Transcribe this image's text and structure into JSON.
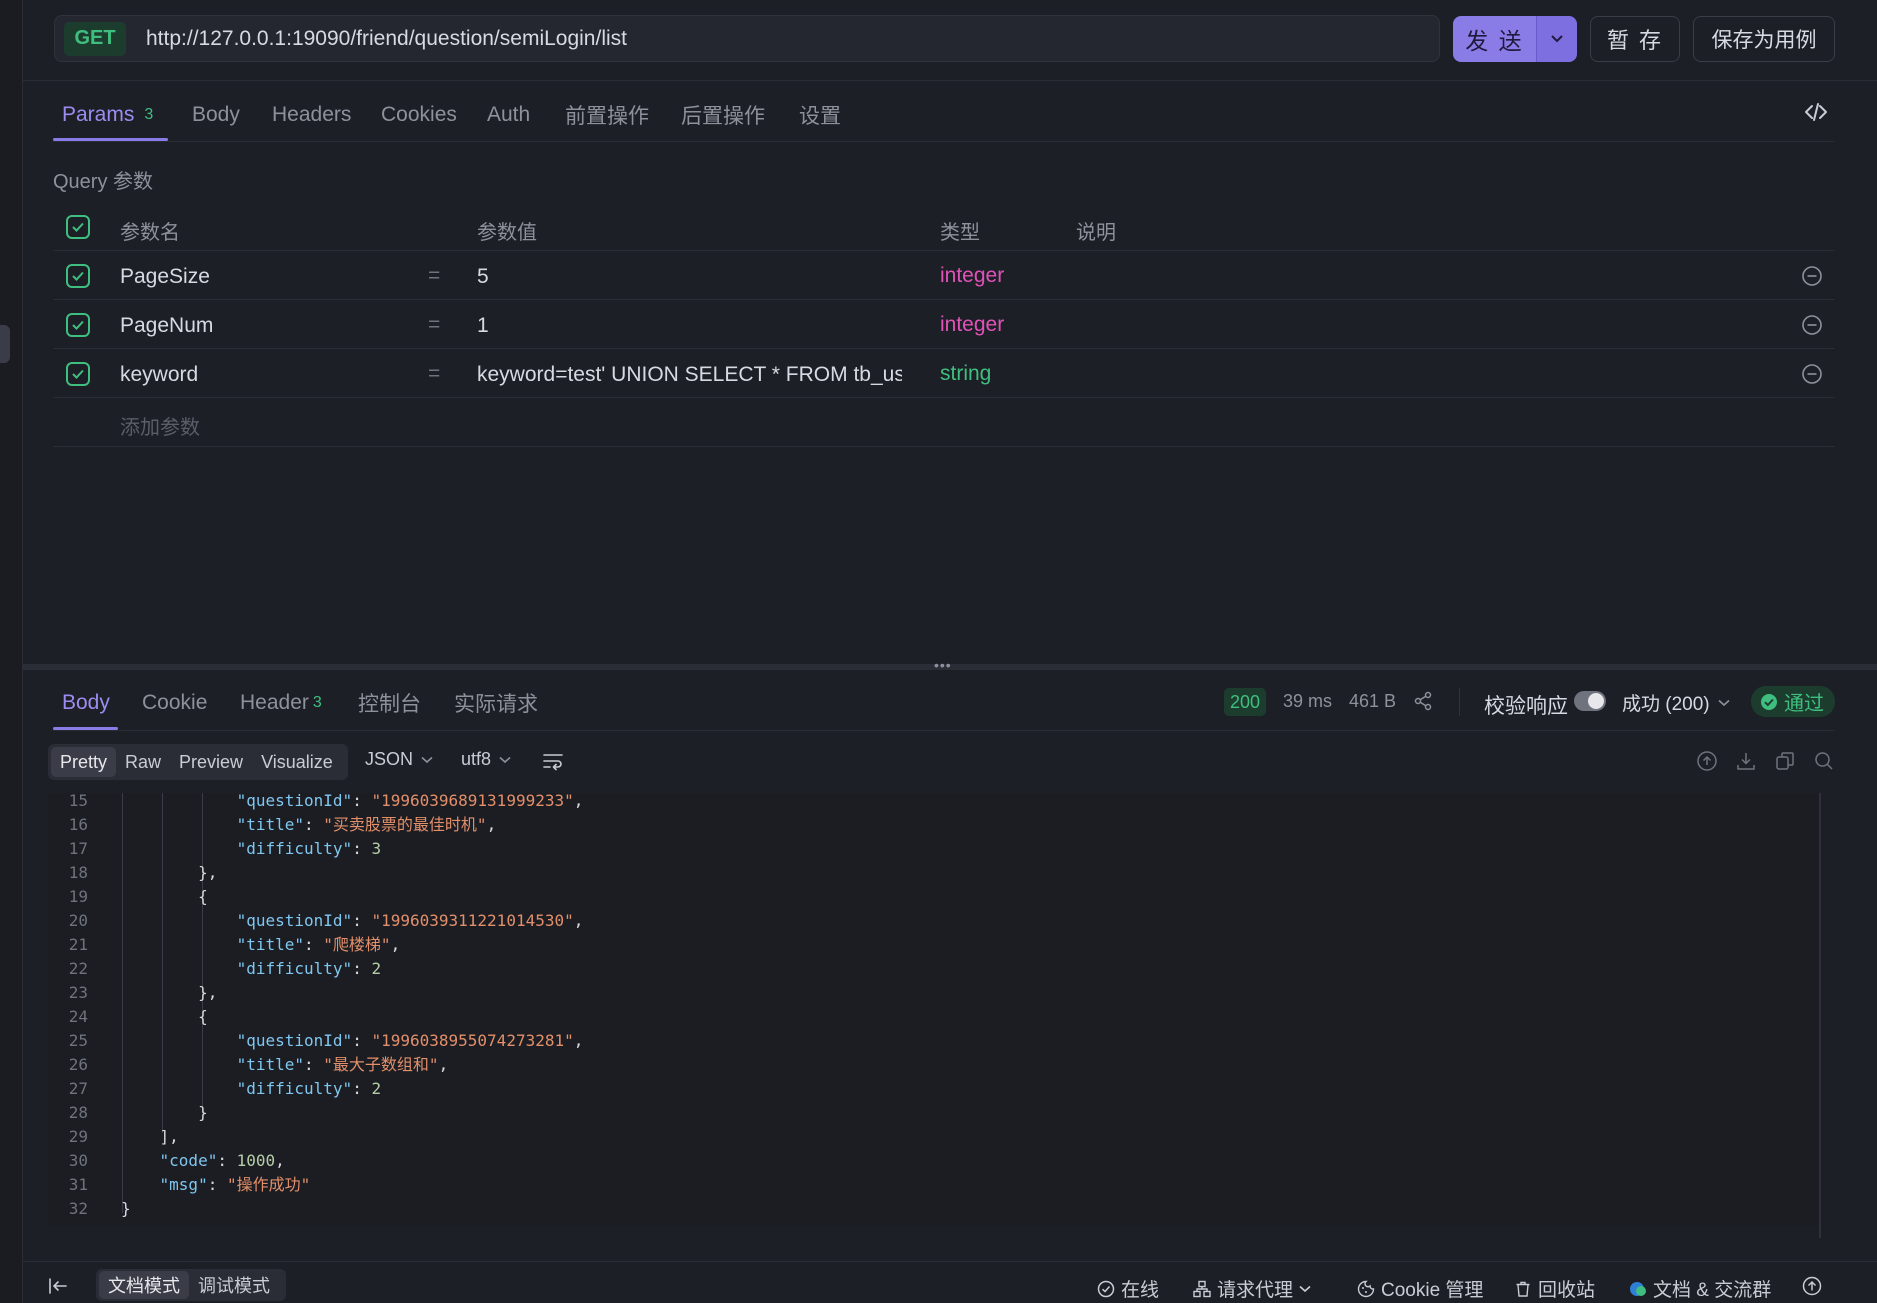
{
  "request": {
    "method": "GET",
    "url": "http://127.0.0.1:19090/friend/question/semiLogin/list",
    "send_label": "发 送",
    "stash_label": "暂 存",
    "save_case_label": "保存为用例"
  },
  "request_tabs": [
    {
      "label": "Params",
      "count": "3"
    },
    {
      "label": "Body"
    },
    {
      "label": "Headers"
    },
    {
      "label": "Cookies"
    },
    {
      "label": "Auth"
    },
    {
      "label": "前置操作"
    },
    {
      "label": "后置操作"
    },
    {
      "label": "设置"
    }
  ],
  "query": {
    "section_label": "Query 参数",
    "headers": {
      "name": "参数名",
      "value": "参数值",
      "type": "类型",
      "desc": "说明"
    },
    "rows": [
      {
        "name": "PageSize",
        "eq": "=",
        "value": "5",
        "type": "integer"
      },
      {
        "name": "PageNum",
        "eq": "=",
        "value": "1",
        "type": "integer"
      },
      {
        "name": "keyword",
        "eq": "=",
        "value": "keyword=test' UNION SELECT * FROM tb_user",
        "type": "string"
      }
    ],
    "add_placeholder": "添加参数"
  },
  "response_tabs": [
    {
      "label": "Body"
    },
    {
      "label": "Cookie"
    },
    {
      "label": "Header",
      "count": "3"
    },
    {
      "label": "控制台"
    },
    {
      "label": "实际请求"
    }
  ],
  "response_meta": {
    "status": "200",
    "time": "39 ms",
    "size": "461 B",
    "validate_label": "校验响应",
    "validate_on": true,
    "expect_select": "成功 (200)",
    "pass_label": "通过"
  },
  "format_toolbar": {
    "modes": [
      "Pretty",
      "Raw",
      "Preview",
      "Visualize"
    ],
    "active_mode": "Pretty",
    "format": "JSON",
    "encoding": "utf8"
  },
  "code_lines": [
    {
      "n": "15",
      "indent": 3,
      "tokens": [
        [
          "k",
          "\"questionId\""
        ],
        [
          "p",
          ": "
        ],
        [
          "s",
          "\"1996039689131999233\""
        ],
        [
          "p",
          ","
        ]
      ]
    },
    {
      "n": "16",
      "indent": 3,
      "tokens": [
        [
          "k",
          "\"title\""
        ],
        [
          "p",
          ": "
        ],
        [
          "s",
          "\"买卖股票的最佳时机\""
        ],
        [
          "p",
          ","
        ]
      ]
    },
    {
      "n": "17",
      "indent": 3,
      "tokens": [
        [
          "k",
          "\"difficulty\""
        ],
        [
          "p",
          ": "
        ],
        [
          "n",
          "3"
        ]
      ]
    },
    {
      "n": "18",
      "indent": 2,
      "tokens": [
        [
          "p",
          "},"
        ]
      ]
    },
    {
      "n": "19",
      "indent": 2,
      "tokens": [
        [
          "p",
          "{"
        ]
      ]
    },
    {
      "n": "20",
      "indent": 3,
      "tokens": [
        [
          "k",
          "\"questionId\""
        ],
        [
          "p",
          ": "
        ],
        [
          "s",
          "\"1996039311221014530\""
        ],
        [
          "p",
          ","
        ]
      ]
    },
    {
      "n": "21",
      "indent": 3,
      "tokens": [
        [
          "k",
          "\"title\""
        ],
        [
          "p",
          ": "
        ],
        [
          "s",
          "\"爬楼梯\""
        ],
        [
          "p",
          ","
        ]
      ]
    },
    {
      "n": "22",
      "indent": 3,
      "tokens": [
        [
          "k",
          "\"difficulty\""
        ],
        [
          "p",
          ": "
        ],
        [
          "n",
          "2"
        ]
      ]
    },
    {
      "n": "23",
      "indent": 2,
      "tokens": [
        [
          "p",
          "},"
        ]
      ]
    },
    {
      "n": "24",
      "indent": 2,
      "tokens": [
        [
          "p",
          "{"
        ]
      ]
    },
    {
      "n": "25",
      "indent": 3,
      "tokens": [
        [
          "k",
          "\"questionId\""
        ],
        [
          "p",
          ": "
        ],
        [
          "s",
          "\"1996038955074273281\""
        ],
        [
          "p",
          ","
        ]
      ]
    },
    {
      "n": "26",
      "indent": 3,
      "tokens": [
        [
          "k",
          "\"title\""
        ],
        [
          "p",
          ": "
        ],
        [
          "s",
          "\"最大子数组和\""
        ],
        [
          "p",
          ","
        ]
      ]
    },
    {
      "n": "27",
      "indent": 3,
      "tokens": [
        [
          "k",
          "\"difficulty\""
        ],
        [
          "p",
          ": "
        ],
        [
          "n",
          "2"
        ]
      ]
    },
    {
      "n": "28",
      "indent": 2,
      "tokens": [
        [
          "p",
          "}"
        ]
      ]
    },
    {
      "n": "29",
      "indent": 1,
      "tokens": [
        [
          "p",
          "],"
        ]
      ]
    },
    {
      "n": "30",
      "indent": 1,
      "tokens": [
        [
          "k",
          "\"code\""
        ],
        [
          "p",
          ": "
        ],
        [
          "n",
          "1000"
        ],
        [
          "p",
          ","
        ]
      ]
    },
    {
      "n": "31",
      "indent": 1,
      "tokens": [
        [
          "k",
          "\"msg\""
        ],
        [
          "p",
          ": "
        ],
        [
          "s",
          "\"操作成功\""
        ]
      ]
    },
    {
      "n": "32",
      "indent": 0,
      "tokens": [
        [
          "p",
          "}"
        ]
      ]
    }
  ],
  "bottom_bar": {
    "modes": [
      "文档模式",
      "调试模式"
    ],
    "active_mode": "文档模式",
    "online": "在线",
    "proxy": "请求代理",
    "cookie_mgr": "Cookie 管理",
    "recycle": "回收站",
    "docs": "文档 & 交流群"
  },
  "colors": {
    "accent": "#8a7ce6",
    "success": "#3fbf7f",
    "integer_type": "#e052b8",
    "background": "#1d1f26"
  }
}
